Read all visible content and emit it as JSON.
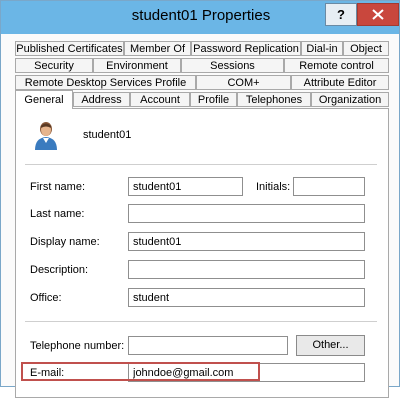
{
  "window": {
    "title": "student01 Properties"
  },
  "titlebar": {
    "help_label": "?"
  },
  "tabs": {
    "row1": [
      "Published Certificates",
      "Member Of",
      "Password Replication",
      "Dial-in",
      "Object"
    ],
    "row2": [
      "Security",
      "Environment",
      "Sessions",
      "Remote control"
    ],
    "row3": [
      "Remote Desktop Services Profile",
      "COM+",
      "Attribute Editor"
    ],
    "row4": [
      "General",
      "Address",
      "Account",
      "Profile",
      "Telephones",
      "Organization"
    ],
    "active": "General"
  },
  "general": {
    "display_username": "student01",
    "first_name_label": "First name:",
    "first_name_value": "student01",
    "initials_label": "Initials:",
    "initials_value": "",
    "last_name_label": "Last name:",
    "last_name_value": "",
    "display_name_label": "Display name:",
    "display_name_value": "student01",
    "description_label": "Description:",
    "description_value": "",
    "office_label": "Office:",
    "office_value": "student",
    "telephone_label": "Telephone number:",
    "telephone_value": "",
    "other_button_label": "Other...",
    "email_label": "E-mail:",
    "email_value": "johndoe@gmail.com"
  },
  "colors": {
    "titlebar": "#6bb6e6",
    "close_button": "#c9473d",
    "highlight": "#c0504d"
  }
}
